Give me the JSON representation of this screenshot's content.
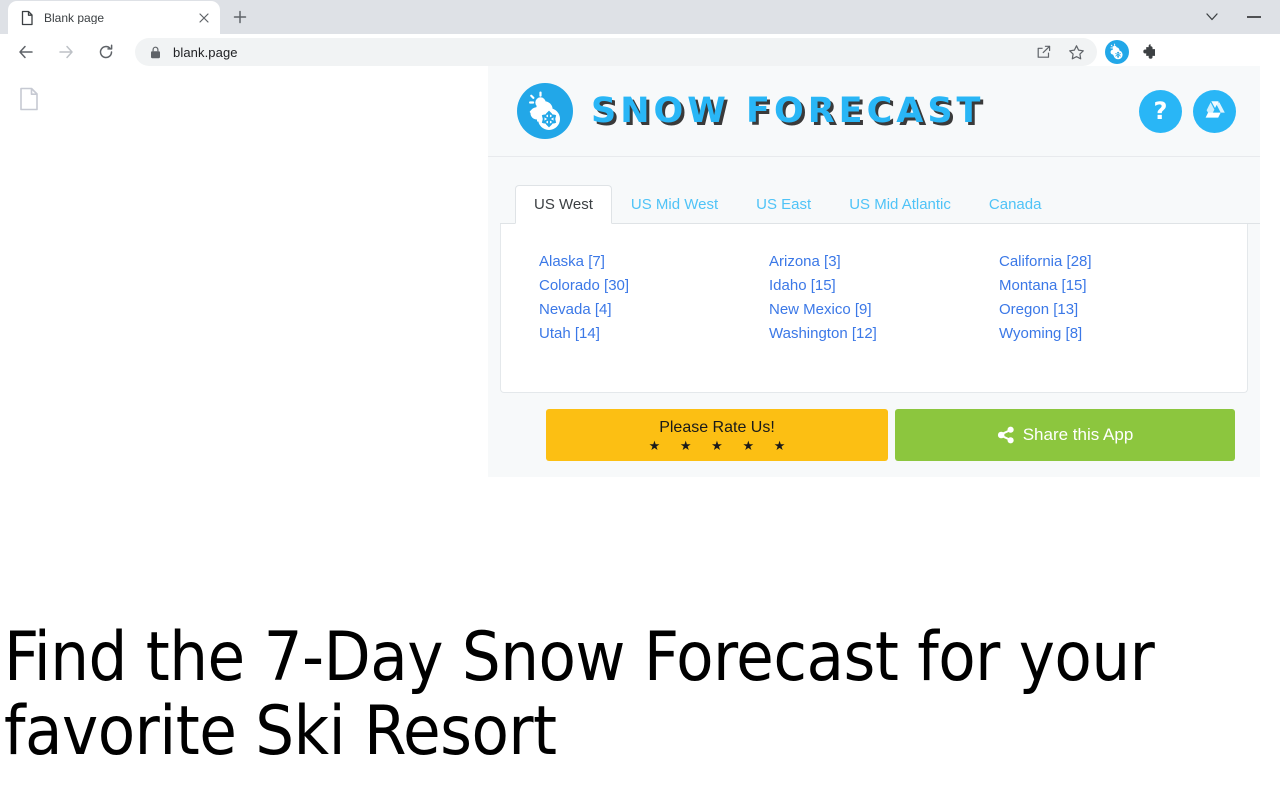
{
  "browser": {
    "tab": {
      "title": "Blank page",
      "favicon_icon": "page-icon",
      "close_icon": "close-icon"
    },
    "new_tab_label": "+",
    "tab_search_icon": "chevron-down-icon",
    "minimize_icon": "minimize-icon",
    "nav": {
      "back_icon": "back-arrow-icon",
      "forward_icon": "forward-arrow-icon",
      "reload_icon": "reload-icon"
    },
    "omnibox": {
      "url": "blank.page",
      "lock_icon": "lock-icon",
      "share_icon": "share-page-icon",
      "bookmark_icon": "star-icon"
    },
    "extension_icon": "snow-forecast-extension-icon",
    "extensions_menu_icon": "puzzle-piece-icon"
  },
  "page": {
    "doc_icon": "document-icon",
    "headline": "Find the 7-Day Snow Forecast for your favorite Ski Resort"
  },
  "popup": {
    "logo_icon": "sun-cloud-snowflake-icon",
    "brand_title": "SNOW FORECAST",
    "help_button": {
      "label": "?",
      "icon": "question-mark-icon"
    },
    "drive_button": {
      "icon": "google-drive-icon"
    },
    "tabs": [
      {
        "label": "US West",
        "active": true
      },
      {
        "label": "US Mid West",
        "active": false
      },
      {
        "label": "US East",
        "active": false
      },
      {
        "label": "US Mid Atlantic",
        "active": false
      },
      {
        "label": "Canada",
        "active": false
      }
    ],
    "states": [
      {
        "name": "Alaska",
        "count": "[7]",
        "label": "Alaska [7]"
      },
      {
        "name": "Arizona",
        "count": "[3]",
        "label": "Arizona [3]"
      },
      {
        "name": "California",
        "count": "[28]",
        "label": "California [28]"
      },
      {
        "name": "Colorado",
        "count": "[30]",
        "label": "Colorado [30]"
      },
      {
        "name": "Idaho",
        "count": "[15]",
        "label": "Idaho [15]"
      },
      {
        "name": "Montana",
        "count": "[15]",
        "label": "Montana [15]"
      },
      {
        "name": "Nevada",
        "count": "[4]",
        "label": "Nevada [4]"
      },
      {
        "name": "New Mexico",
        "count": "[9]",
        "label": "New Mexico [9]"
      },
      {
        "name": "Oregon",
        "count": "[13]",
        "label": "Oregon [13]"
      },
      {
        "name": "Utah",
        "count": "[14]",
        "label": "Utah [14]"
      },
      {
        "name": "Washington",
        "count": "[12]",
        "label": "Washington [12]"
      },
      {
        "name": "Wyoming",
        "count": "[8]",
        "label": "Wyoming [8]"
      }
    ],
    "rate_button": {
      "label": "Please Rate Us!",
      "stars": "★ ★ ★ ★ ★"
    },
    "share_button": {
      "label": "Share this App",
      "icon": "share-icon"
    }
  },
  "colors": {
    "brand_blue": "#29b6f6",
    "logo_blue": "#22a7e8",
    "link_blue": "#3b78e7",
    "tab_inactive_blue": "#4fc3f7",
    "rate_amber": "#fcbf13",
    "share_green": "#8cc63e",
    "popup_bg": "#f7f9fa"
  }
}
